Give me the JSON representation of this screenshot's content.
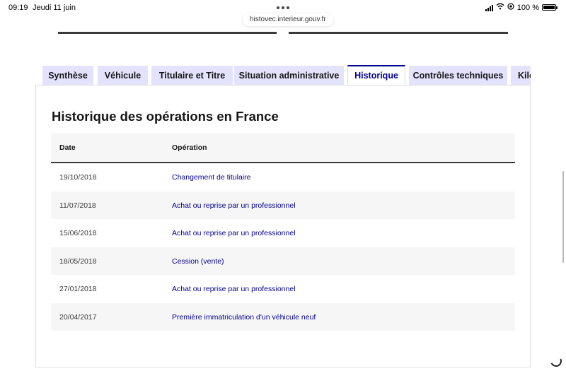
{
  "status_bar": {
    "time": "09:19",
    "date": "Jeudi 11 juin",
    "battery": "100 %"
  },
  "browser": {
    "url": "histovec.interieur.gouv.fr"
  },
  "tabs": [
    {
      "label": "Synthèse"
    },
    {
      "label": "Véhicule"
    },
    {
      "label": "Titulaire et Titre"
    },
    {
      "label": "Situation administrative"
    },
    {
      "label": "Historique",
      "active": true
    },
    {
      "label": "Contrôles techniques"
    },
    {
      "label": "Kilométrage"
    }
  ],
  "panel": {
    "title": "Historique des opérations en France",
    "columns": {
      "date": "Date",
      "operation": "Opération"
    },
    "rows": [
      {
        "date": "19/10/2018",
        "operation": "Changement de titulaire"
      },
      {
        "date": "11/07/2018",
        "operation": "Achat ou reprise par un professionnel"
      },
      {
        "date": "15/06/2018",
        "operation": "Achat ou reprise par un professionnel"
      },
      {
        "date": "18/05/2018",
        "operation": "Cession (vente)"
      },
      {
        "date": "27/01/2018",
        "operation": "Achat ou reprise par un professionnel"
      },
      {
        "date": "20/04/2017",
        "operation": "Première immatriculation d'un véhicule neuf"
      }
    ]
  },
  "colors": {
    "accent": "#000091",
    "tab_bg": "#e3e3fd",
    "stripe": "#f6f6f6"
  }
}
